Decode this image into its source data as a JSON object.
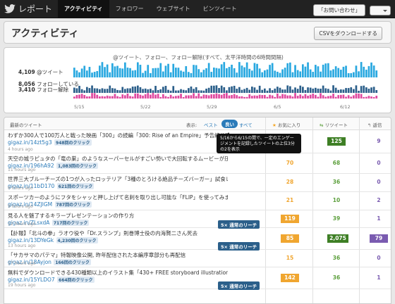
{
  "app": {
    "brand": "レポート"
  },
  "nav": [
    "アクティビティ",
    "フォロワー",
    "ウェブサイト",
    "ビンツイート"
  ],
  "topright": {
    "inquiry": "「お問い合わせ」"
  },
  "page": {
    "title": "アクティビティ",
    "csv_button": "CSVをダウンロードする"
  },
  "chart_data": {
    "type": "bar",
    "title": "@ツイート、フォロー、フォロー解除(すべて、太平洋時間の6時間間隔)",
    "x_ticks": [
      "5/15",
      "5/22",
      "5/29",
      "6/5",
      "6/12"
    ],
    "series": [
      {
        "name": "@ツイート",
        "total_label": "4,109",
        "color": "#29a8e0"
      },
      {
        "name": "フォローしている",
        "total_label": "8,056",
        "color": "#2b5f8a"
      },
      {
        "name": "フォロー解除",
        "total_label": "3,410",
        "color": "#e0489f"
      }
    ]
  },
  "table": {
    "headers": {
      "tweets": "最新のツイート",
      "show": "表示:",
      "best": "ベスト",
      "good": "良い",
      "all": "すべて",
      "favorites": "お気に入り",
      "retweets": "リツイート",
      "replies": "返信"
    },
    "tooltip": "5/16から6/15の間で、一定のエンゲージメントを記録したツイートの上位3分の2を表示",
    "rows": [
      {
        "text": "わずか300人で100万人と戦った映画「300」の続編「300: Rise of an Empire」予告編公開, ビジュ",
        "link": "gigaz.in/14zt5g3",
        "clicks": "948回のクリック",
        "age": "4 hours ago",
        "fav": "",
        "rt": "125",
        "rep": "9"
      },
      {
        "text": "天空の城ラピュタの「竜の巣」のようなスーパーセルがすごい勢いで大回転するムービーが圧巻",
        "link": "gigaz.in/196hA92",
        "clicks": "1,083回のクリック",
        "age": "11 hours ago",
        "fav": "70",
        "rt": "68",
        "rep": "0"
      },
      {
        "text": "世界三大ブルーチーズの1つが入ったロッテリア「3種のとろける絶品チーズバーガー」試食レビュー",
        "link": "gigaz.in/11bD170",
        "clicks": "621回のクリック",
        "age": "6 hours ago",
        "fav": "28",
        "rt": "36",
        "rep": "0"
      },
      {
        "text": "スポーツカーのようにフタをシャッと押し上げて名刺を取り出し可能な「FLIP」を使ってみました",
        "link": "gigaz.in/14ZJlGM",
        "clicks": "787回のクリック",
        "age": "9 hours ago",
        "fav": "21",
        "rt": "10",
        "rep": "2"
      },
      {
        "text": "見る人を魅了するキラープレゼンテーションの作り方",
        "link": "gigaz.in/ZLsxdA",
        "clicks": "717回のクリック",
        "age": "12 hours ago",
        "reach": "5× 通常のリーチ",
        "fav": "119",
        "rt": "39",
        "rep": "1"
      },
      {
        "text": "【訃報】「北斗の拳」ラオウ役や「Dr.スランプ」則巻博士役の内海賢二さん死去",
        "link": "gigaz.in/13DYeGk",
        "clicks": "4,230回のクリック",
        "age": "13 hours ago",
        "reach": "5× 通常のリーチ",
        "fav": "85",
        "rt": "2,075",
        "rep": "79"
      },
      {
        "text": "「サカサマのパテマ」特報映像公開, 昨年配信された本編序章部分も再配信",
        "link": "gigaz.in/18Ayjon",
        "clicks": "166回のクリック",
        "age": "17 hours ago",
        "fav": "15",
        "rt": "36",
        "rep": "0"
      },
      {
        "text": "無料でダウンロードできる430種類以上のイラスト集「430+ FREE storyboard illustrations」",
        "link": "gigaz.in/15YLDO7",
        "clicks": "664回のクリック",
        "age": "19 hours ago",
        "reach": "5× 通常のリーチ",
        "fav": "142",
        "rt": "36",
        "rep": "1"
      }
    ]
  }
}
